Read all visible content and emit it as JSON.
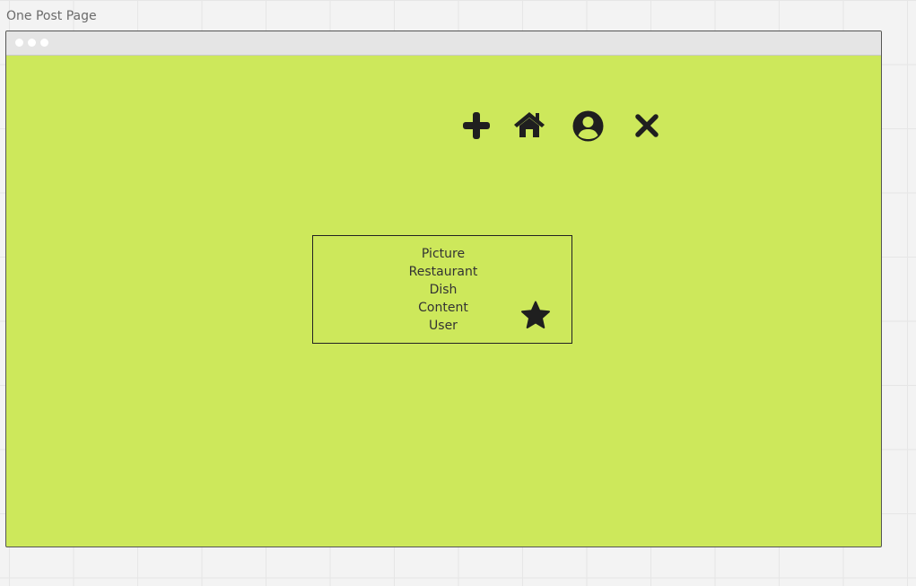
{
  "frame": {
    "label": "One Post Page"
  },
  "browser": {
    "background": "#cde85b",
    "titlebar_dots": [
      "dot",
      "dot",
      "dot"
    ]
  },
  "nav_icons": [
    {
      "name": "plus-icon"
    },
    {
      "name": "home-icon"
    },
    {
      "name": "user-circle-icon"
    },
    {
      "name": "close-icon"
    }
  ],
  "post": {
    "fields": [
      "Picture",
      "Restaurant",
      "Dish",
      "Content",
      "User"
    ],
    "favorite_icon": "star-icon"
  }
}
